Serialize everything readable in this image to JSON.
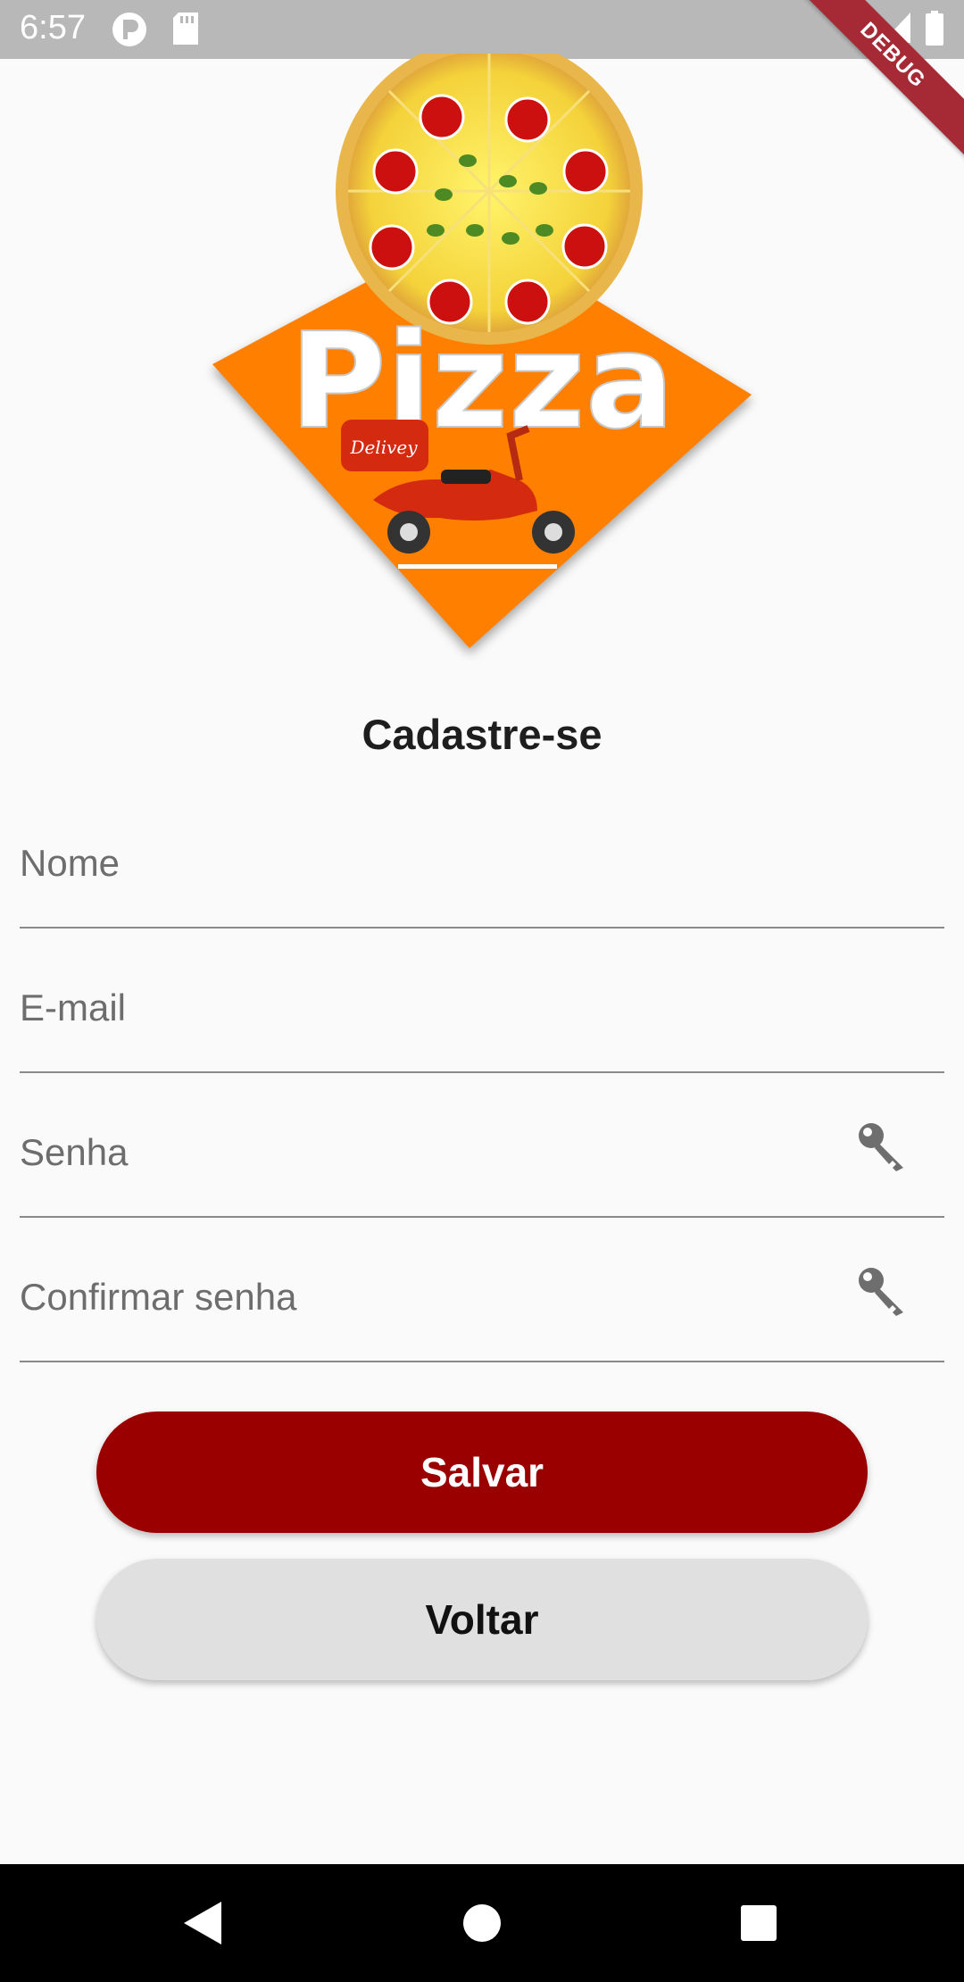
{
  "status_bar": {
    "time": "6:57",
    "icons": [
      "p-circle-icon",
      "sd-card-icon",
      "wifi-icon",
      "signal-icon",
      "battery-icon"
    ]
  },
  "debug_banner": "DEBUG",
  "logo": {
    "wordmark": "Pizza",
    "tag": "Delivey",
    "colors": {
      "orange": "#ff8000",
      "crust": "#f0c040",
      "pepperoni": "#cc1010",
      "scooter": "#d42a10"
    }
  },
  "form": {
    "title": "Cadastre-se",
    "fields": [
      {
        "placeholder": "Nome",
        "value": ""
      },
      {
        "placeholder": "E-mail",
        "value": ""
      },
      {
        "placeholder": "Senha",
        "value": "",
        "icon": "key-icon"
      },
      {
        "placeholder": "Confirmar senha",
        "value": "",
        "icon": "key-icon"
      }
    ],
    "save_label": "Salvar",
    "back_label": "Voltar"
  },
  "colors": {
    "primary": "#9b0000",
    "secondary_button": "#e0e0e0",
    "background": "#fafafa",
    "status_bar": "#b8b8b8",
    "nav_bar": "#000000"
  },
  "nav_bar": {
    "icons": [
      "back-icon",
      "home-icon",
      "recents-icon"
    ]
  }
}
